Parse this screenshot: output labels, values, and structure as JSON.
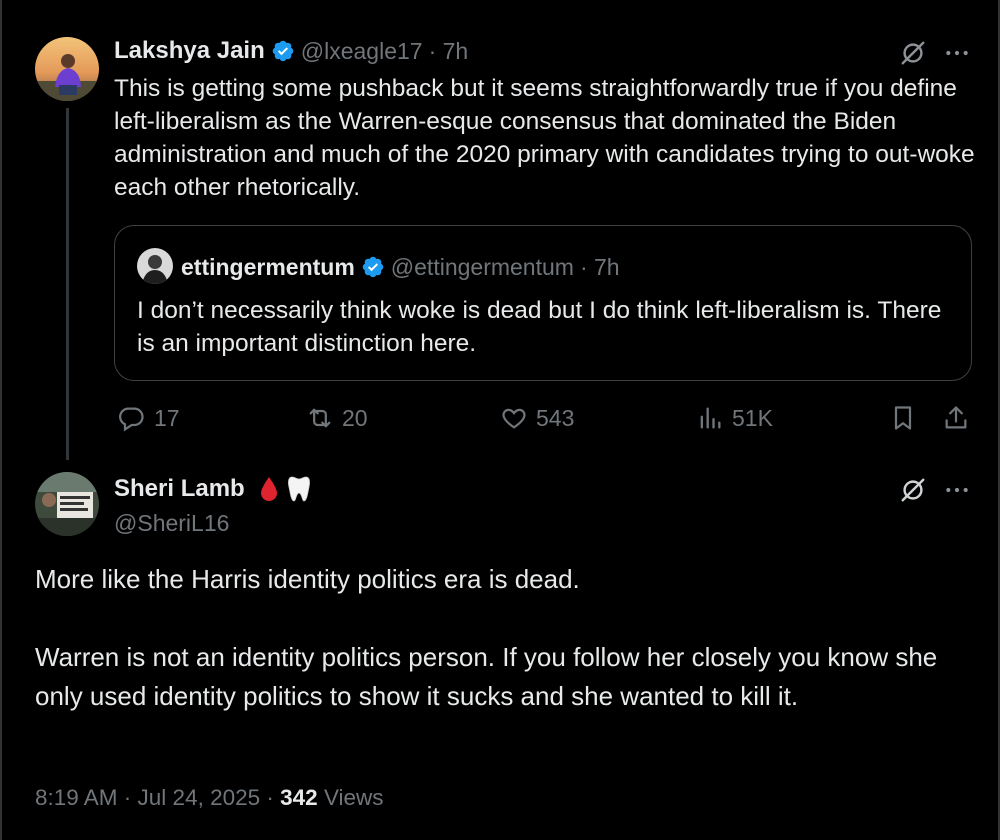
{
  "tweet1": {
    "author_name": "Lakshya Jain",
    "handle": "@lxeagle17",
    "time": "· 7h",
    "text": "This is getting some pushback but it seems straightforwardly true if you define left-liberalism as the Warren-esque consensus that dominated the Biden administration and much of the 2020 primary with candidates trying to out-woke each other rhetorically.",
    "quote": {
      "author_name": "ettingermentum",
      "handle": "@ettingermentum",
      "time": "· 7h",
      "text": "I don’t necessarily think woke is dead but I do think left-liberalism is. There is an important distinction here."
    },
    "actions": {
      "replies": "17",
      "reposts": "20",
      "likes": "543",
      "views": "51K"
    }
  },
  "tweet2": {
    "author_name": "Sheri Lamb",
    "handle": "@SheriL16",
    "paragraphs": [
      "More like the Harris identity politics era is dead.",
      "Warren is not an identity politics person. If you follow her closely you know she only used identity politics to show it sucks and she wanted to kill it."
    ],
    "meta": {
      "timestamp": "8:19 AM · Jul 24, 2025 · ",
      "view_count": "342",
      "views_label": " Views"
    }
  },
  "colors": {
    "background": "#000000",
    "text": "#e7e9ea",
    "muted": "#71767b",
    "verified": "#1d9bf0",
    "border": "#2f3336"
  },
  "icons": [
    "verified-badge-icon",
    "grok-icon",
    "more-icon",
    "reply-icon",
    "repost-icon",
    "like-icon",
    "views-icon",
    "bookmark-icon",
    "share-icon",
    "blood-drop-icon",
    "tooth-icon"
  ]
}
